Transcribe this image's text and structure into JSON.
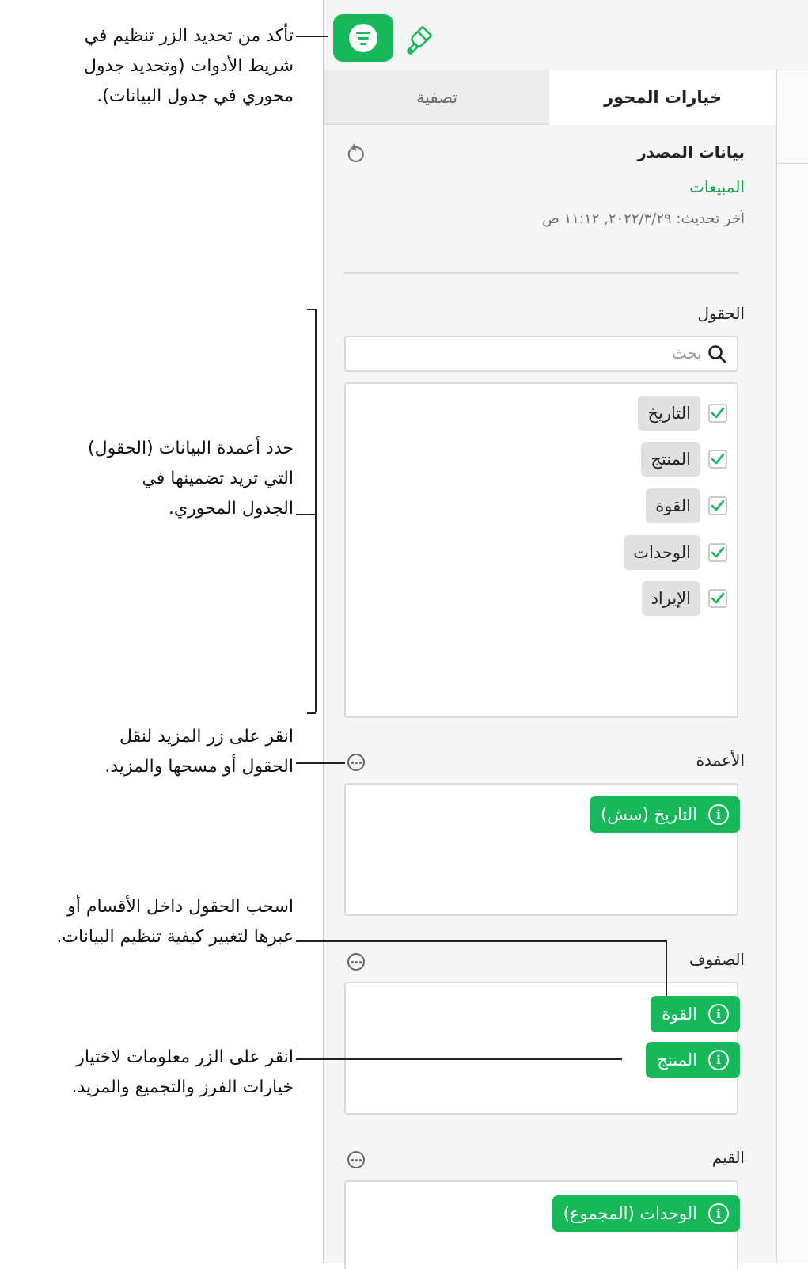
{
  "callouts": {
    "organize": [
      "تأكد من تحديد الزر تنظيم في",
      "شريط الأدوات (وتحديد جدول",
      "محوري في جدول البيانات)."
    ],
    "fields": [
      "حدد أعمدة البيانات (الحقول)",
      "التي تريد تضمينها في",
      "الجدول المحوري."
    ],
    "more": [
      "انقر على زر المزيد لنقل",
      "الحقول أو مسحها والمزيد."
    ],
    "drag": [
      "اسحب الحقول داخل الأقسام أو",
      "عبرها لتغيير كيفية تنظيم البيانات."
    ],
    "info": [
      "انقر على الزر معلومات لاختيار",
      "خيارات الفرز والتجميع والمزيد."
    ]
  },
  "toolbar": {
    "organize_icon": "organize-icon",
    "format_icon": "paintbrush-icon",
    "accent": "#16b85a"
  },
  "tabs": {
    "pivot_options": "خيارات المحور",
    "filter": "تصفية"
  },
  "source": {
    "title": "بيانات المصدر",
    "name": "المبيعات",
    "last_updated": "آخر تحديث: ٢٠٢٢/٣/٢٩, ١١:١٢ ص",
    "refresh_icon": "refresh-icon"
  },
  "fields": {
    "title": "الحقول",
    "search_placeholder": "بحث",
    "items": [
      {
        "label": "التاريخ",
        "checked": true
      },
      {
        "label": "المنتج",
        "checked": true
      },
      {
        "label": "القوة",
        "checked": true
      },
      {
        "label": "الوحدات",
        "checked": true
      },
      {
        "label": "الإيراد",
        "checked": true
      }
    ]
  },
  "columns": {
    "title": "الأعمدة",
    "pills": [
      "التاريخ (سش)"
    ]
  },
  "rows": {
    "title": "الصفوف",
    "pills": [
      "القوة",
      "المنتج"
    ]
  },
  "values": {
    "title": "القيم",
    "pills": [
      "الوحدات (المجموع)"
    ]
  }
}
